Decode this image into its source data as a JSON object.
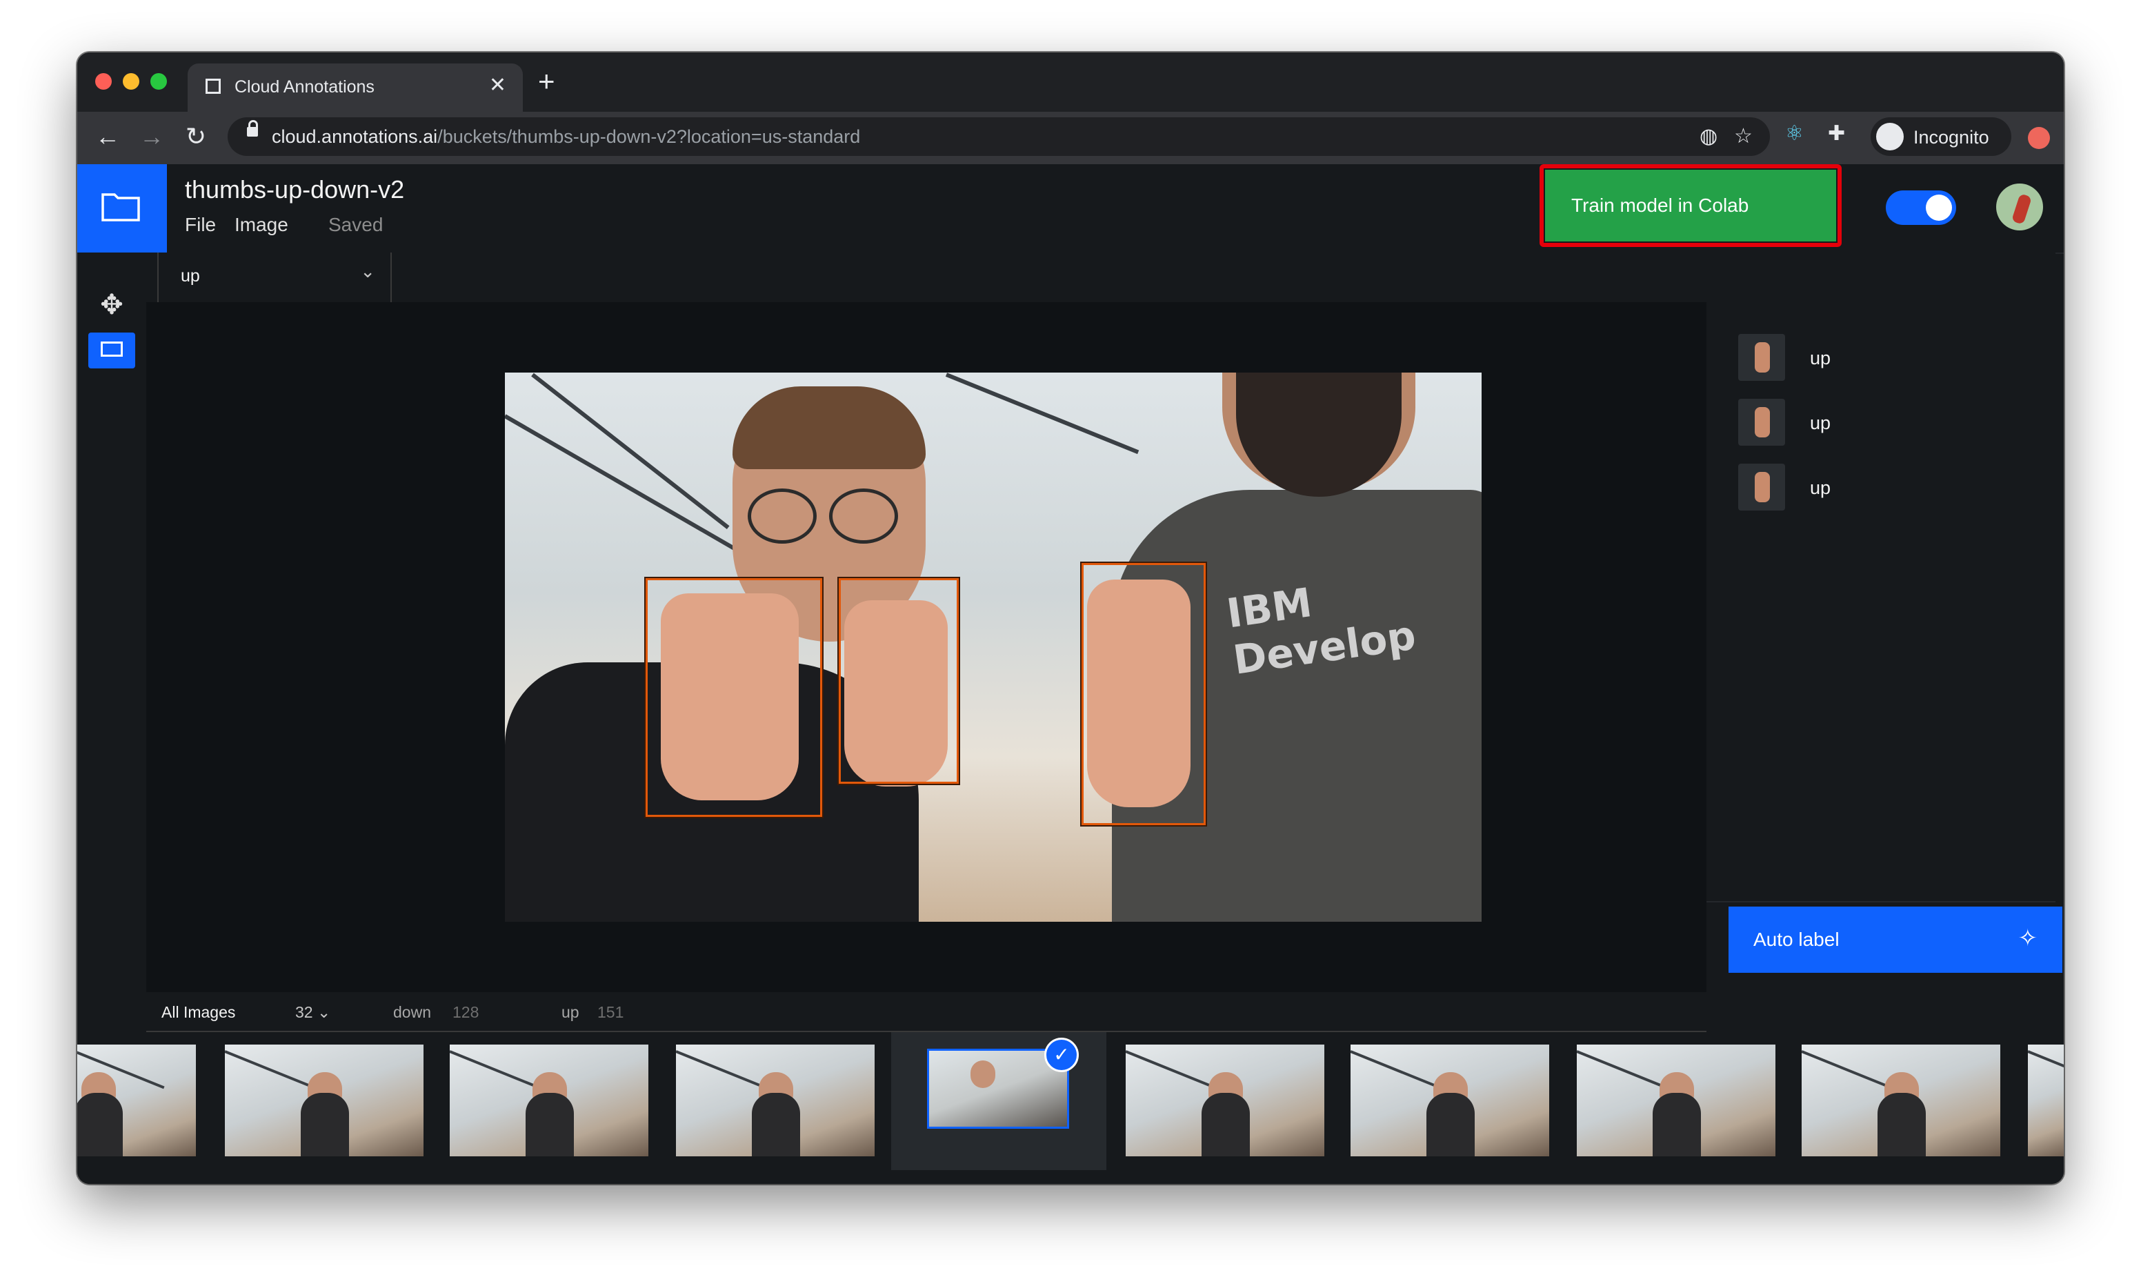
{
  "browser": {
    "tab_title": "Cloud Annotations",
    "tab_close": "✕",
    "new_tab": "+",
    "url_host": "cloud.annotations.ai",
    "url_path": "/buckets/thumbs-up-down-v2?location=us-standard",
    "profile_label": "Incognito"
  },
  "app": {
    "bucket_name": "thumbs-up-down-v2",
    "menu": [
      "File",
      "Image"
    ],
    "save_status": "Saved",
    "train_button": "Train model in Colab",
    "toggle_on": true
  },
  "label_select": {
    "value": "up",
    "chevron": "⌄"
  },
  "tools": [
    "move-tool",
    "box-tool"
  ],
  "annotations": [
    {
      "label": "up"
    },
    {
      "label": "up"
    },
    {
      "label": "up"
    }
  ],
  "image": {
    "shirt_text": "IBM Develop"
  },
  "auto_label_button": "Auto label",
  "filters": {
    "all_label": "All Images",
    "all_count": "32 ⌄",
    "down_label": "down",
    "down_count": "128",
    "up_label": "up",
    "up_count": "151"
  },
  "filmstrip": {
    "selected_check": "✓"
  },
  "colors": {
    "accent": "#0f62fe",
    "train_green": "#24a148",
    "highlight_red": "#e5000a",
    "bbox_orange": "#e2580a"
  }
}
